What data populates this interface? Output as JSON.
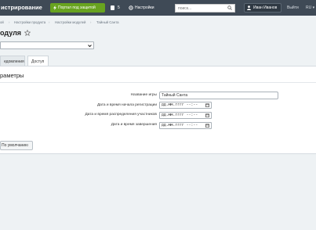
{
  "header": {
    "brand": "истрирование",
    "portal_button": "Портал под защитой",
    "counter": "5",
    "settings": "Настройки",
    "search_placeholder": "поиск...",
    "user_name": "Иван Иванов",
    "logout": "Выйти",
    "lang": "RU"
  },
  "breadcrumbs": [
    "ой",
    "Настройки продукта",
    "Настройки модулей",
    "Тайный Санта"
  ],
  "page": {
    "title": "одуля"
  },
  "tabs": [
    {
      "label": "едомления",
      "active": false
    },
    {
      "label": "Доступ",
      "active": true
    }
  ],
  "panel": {
    "header": "раметры",
    "fields": {
      "name_label": "Название игры",
      "name_value": "Тайный Санта",
      "reg_start_label": "Дата и время начала регистрации",
      "distribution_label": "Дата и время распределения участников",
      "end_label": "Дата и время завершения",
      "datetime_placeholder": "дд.мм.гггг --:--"
    },
    "default_button": "По умолчанию"
  },
  "colors": {
    "topbar": "#3f4a56",
    "portal_button": "#68a31f",
    "background": "#eef2f4"
  }
}
